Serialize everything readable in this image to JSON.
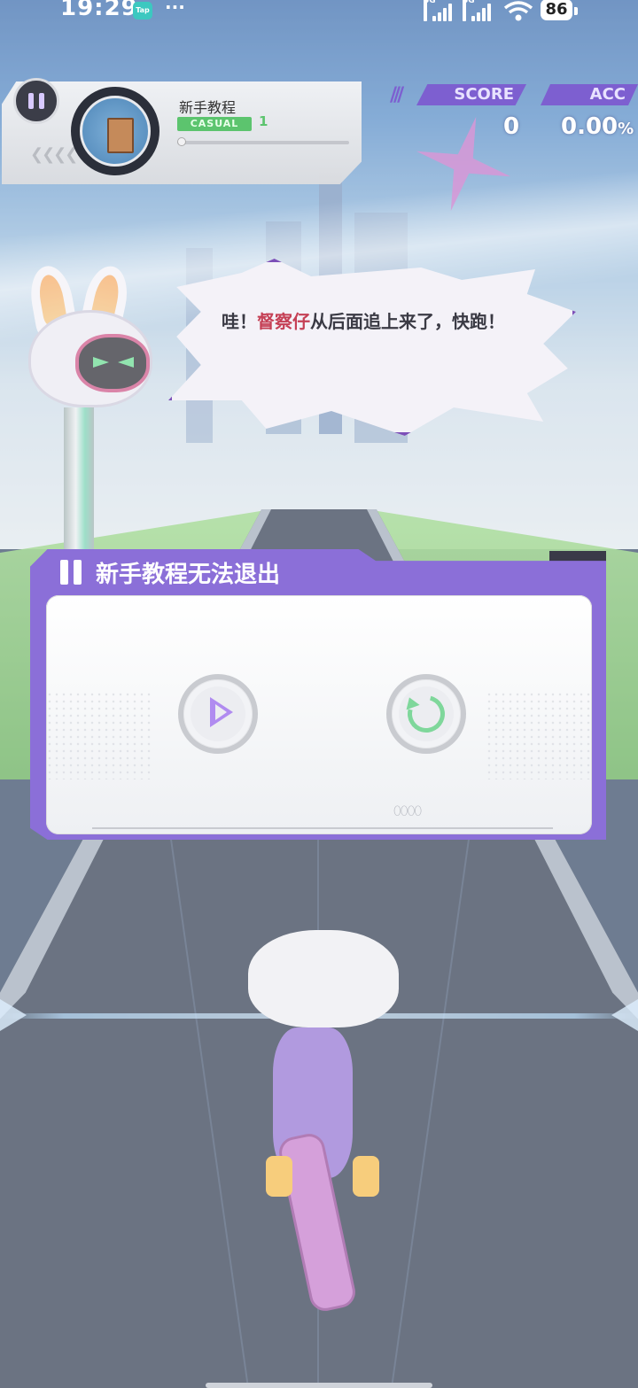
{
  "status_bar": {
    "time": "19:29",
    "app_badge": "Tap",
    "more": "···",
    "network1": "5G",
    "network2": "5G",
    "battery": "86"
  },
  "hud": {
    "song_title": "新手教程",
    "difficulty": "CASUAL",
    "level": "1",
    "progress": 0.0,
    "score_label": "SCORE",
    "score_value": "0",
    "acc_label": "ACC",
    "acc_value": "0.00",
    "acc_unit": "%",
    "pause_icon": "pause-icon",
    "jacket_icon": "book-icon"
  },
  "speech": {
    "prefix": "哇！",
    "highlight": "督察仔",
    "suffix": "从后面追上来了，快跑！"
  },
  "pause_dialog": {
    "title": "新手教程无法退出",
    "resume_icon": "play-icon",
    "retry_icon": "retry-icon"
  },
  "colors": {
    "accent_purple": "#8b6fd8",
    "casual_green": "#5cc46e",
    "highlight_red": "#c54055",
    "resume_purple": "#b08bf0",
    "retry_green": "#7fd79b"
  }
}
